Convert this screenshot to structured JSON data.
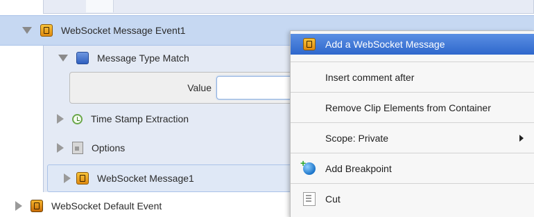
{
  "tree": {
    "event": {
      "label": "WebSocket Message Event1",
      "expanded": true,
      "icon": "websocket-event-icon"
    },
    "message_type_match": {
      "label": "Message Type Match",
      "icon": "message-type-icon"
    },
    "value_field": {
      "label": "Value",
      "value": ""
    },
    "timestamp": {
      "label": "Time Stamp Extraction",
      "icon": "clock-icon"
    },
    "options": {
      "label": "Options",
      "icon": "options-icon"
    },
    "ws_message": {
      "label": "WebSocket Message1",
      "icon": "websocket-message-icon"
    },
    "default_event": {
      "label": "WebSocket Default Event",
      "icon": "websocket-event-icon"
    }
  },
  "context_menu": {
    "items": [
      {
        "label": "Add a WebSocket Message",
        "icon": "websocket-message-icon",
        "highlighted": true
      },
      {
        "label": "Insert comment after"
      },
      {
        "label": "Remove Clip Elements from Container"
      },
      {
        "label": "Scope: Private",
        "submenu": true
      },
      {
        "label": "Add Breakpoint",
        "icon": "breakpoint-icon"
      },
      {
        "label": "Cut",
        "icon": "cut-icon"
      }
    ]
  },
  "colors": {
    "selection": "#c6d8f2",
    "menu_highlight": "#2e67cc",
    "panel": "#e4eaf5"
  }
}
